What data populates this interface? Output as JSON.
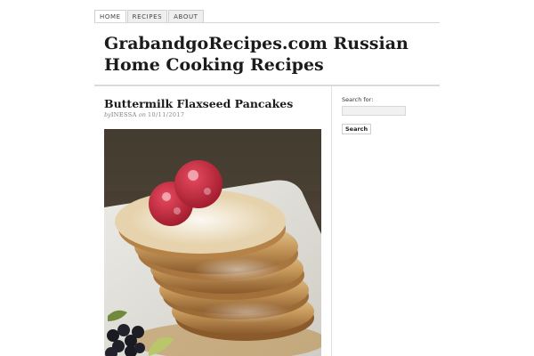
{
  "nav": {
    "items": [
      {
        "label": "HOME",
        "active": true
      },
      {
        "label": "RECIPES",
        "active": false
      },
      {
        "label": "ABOUT",
        "active": false
      }
    ]
  },
  "header": {
    "site_title": "GrabandgoRecipes.com Russian Home Cooking Recipes"
  },
  "post": {
    "title": "Buttermilk Flaxseed Pancakes",
    "by_prefix": "by",
    "author": "INESSA",
    "on_word": "on",
    "date": "10/11/2017",
    "image_icon": "pancake-stack-with-raspberries-photo"
  },
  "sidebar": {
    "search_label": "Search for:",
    "search_placeholder": "",
    "search_button": "Search"
  }
}
